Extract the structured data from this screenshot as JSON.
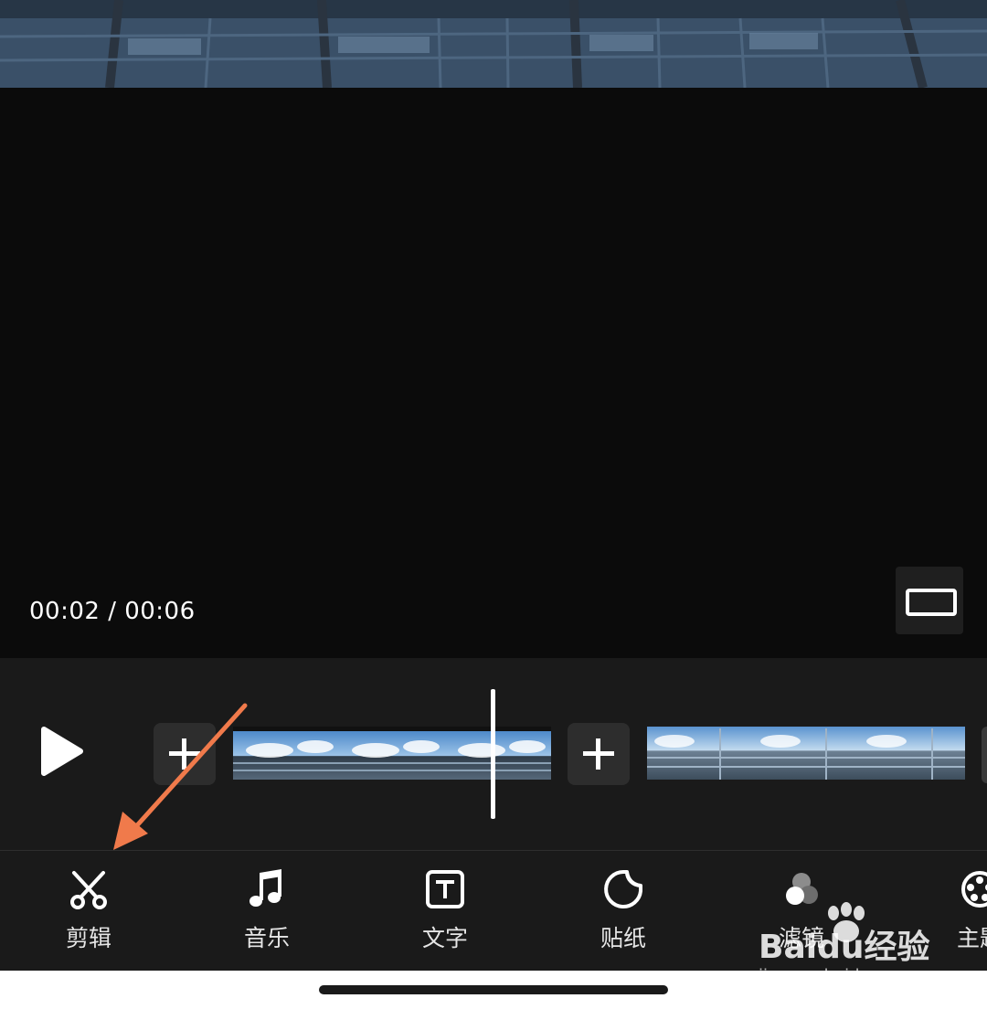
{
  "preview": {
    "timecode": "00:02 / 00:06"
  },
  "timeline": {
    "add_icon": "plus-icon",
    "play_icon": "play-icon"
  },
  "toolbar": {
    "items": [
      {
        "label": "剪辑",
        "icon": "scissors-icon"
      },
      {
        "label": "音乐",
        "icon": "music-note-icon"
      },
      {
        "label": "文字",
        "icon": "text-icon"
      },
      {
        "label": "贴纸",
        "icon": "sticker-icon"
      },
      {
        "label": "滤镜",
        "icon": "filter-icon"
      },
      {
        "label": "主题",
        "icon": "theme-icon"
      }
    ]
  },
  "watermark": {
    "brand": "Baidu经验",
    "url": "jingyan.baidu.com"
  },
  "colors": {
    "annotation_arrow": "#f07a4b",
    "background": "#0b0b0b",
    "panel": "#1a1a1a"
  }
}
